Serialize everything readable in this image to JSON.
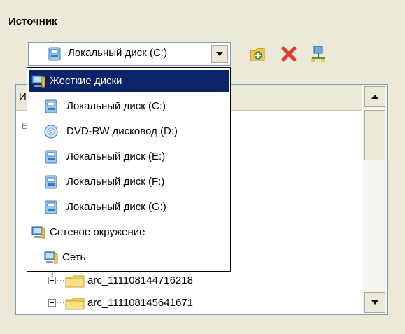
{
  "section": {
    "title": "Источник"
  },
  "source_combo": {
    "value": "Локальный диск (C:)",
    "icon": "hard-disk-icon"
  },
  "toolbar": [
    {
      "name": "add-folder-button",
      "icon": "folder-add-icon"
    },
    {
      "name": "delete-button",
      "icon": "red-x-icon"
    },
    {
      "name": "network-button",
      "icon": "network-icon"
    }
  ],
  "dropdown": {
    "items": [
      {
        "label": "Жесткие диски",
        "icon": "computer-icon",
        "selected": true
      },
      {
        "label": "Локальный диск (C:)",
        "icon": "hard-disk-icon",
        "selected": false
      },
      {
        "label": "DVD-RW дисковод (D:)",
        "icon": "dvd-icon",
        "selected": false
      },
      {
        "label": "Локальный диск (E:)",
        "icon": "hard-disk-icon",
        "selected": false
      },
      {
        "label": "Локальный диск (F:)",
        "icon": "hard-disk-icon",
        "selected": false
      },
      {
        "label": "Локальный диск (G:)",
        "icon": "hard-disk-icon",
        "selected": false
      },
      {
        "label": "Сетевое окружение",
        "icon": "computer-icon",
        "selected": false
      },
      {
        "label": "Сеть",
        "icon": "computer-icon",
        "selected": false
      }
    ]
  },
  "tree": {
    "header_label": "И",
    "stub": "E",
    "rows": [
      {
        "label": "arc_111108144716218",
        "icon": "folder-icon"
      },
      {
        "label": "arc_111108145641671",
        "icon": "folder-icon"
      }
    ]
  },
  "colors": {
    "background": "#ece9d8",
    "selection": "#0a246a",
    "border": "#7f9db9"
  }
}
